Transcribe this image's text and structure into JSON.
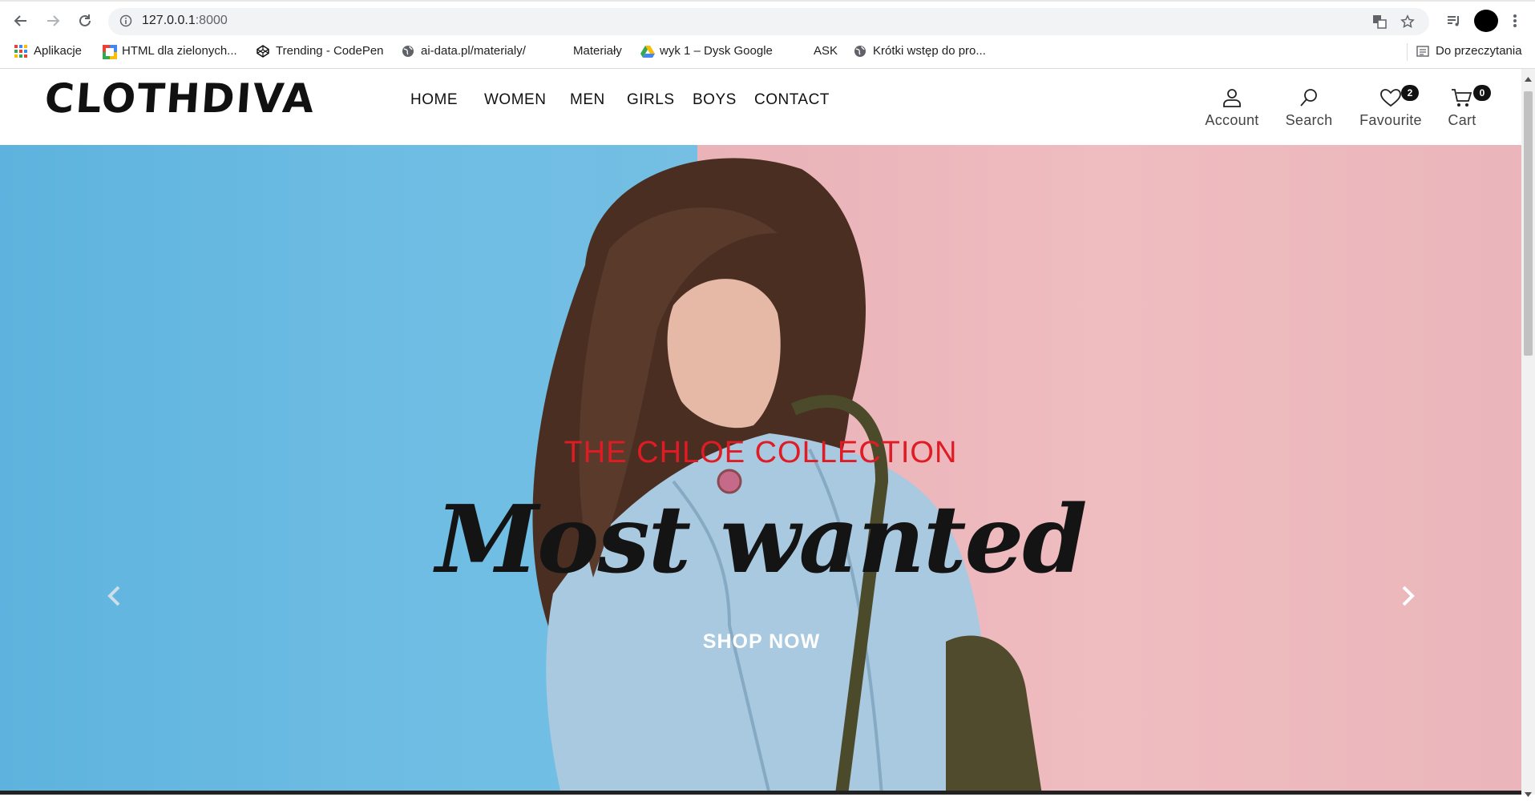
{
  "browser": {
    "url_host": "127.0.0.1",
    "url_port": ":8000",
    "bookmarks": [
      {
        "label": "Aplikacje",
        "icon": "apps-grid-icon"
      },
      {
        "label": "HTML dla zielonych...",
        "icon": "bookmark-favicon-icon"
      },
      {
        "label": "Trending - CodePen",
        "icon": "codepen-icon"
      },
      {
        "label": "ai-data.pl/materialy/",
        "icon": "globe-icon"
      },
      {
        "label": "Materiały",
        "icon": ""
      },
      {
        "label": "wyk 1 – Dysk Google",
        "icon": "google-drive-icon"
      },
      {
        "label": "ASK",
        "icon": ""
      },
      {
        "label": "Krótki wstęp do pro...",
        "icon": "globe-icon"
      }
    ],
    "reading_list": "Do przeczytania"
  },
  "site": {
    "logo": "CLOTHDIVA",
    "menu": [
      "HOME",
      "WOMEN",
      "MEN",
      "GIRLS",
      "BOYS",
      "CONTACT"
    ],
    "actions": {
      "account": "Account",
      "search": "Search",
      "favourite": "Favourite",
      "favourite_count": "2",
      "cart": "Cart",
      "cart_count": "0"
    }
  },
  "hero": {
    "subtitle": "THE CHLOE COLLECTION",
    "headline": "Most wanted",
    "cta": "SHOP NOW"
  },
  "colors": {
    "accent_red": "#e01b24",
    "hero_blue": "#6fbde4",
    "hero_pink": "#efbcc0"
  }
}
